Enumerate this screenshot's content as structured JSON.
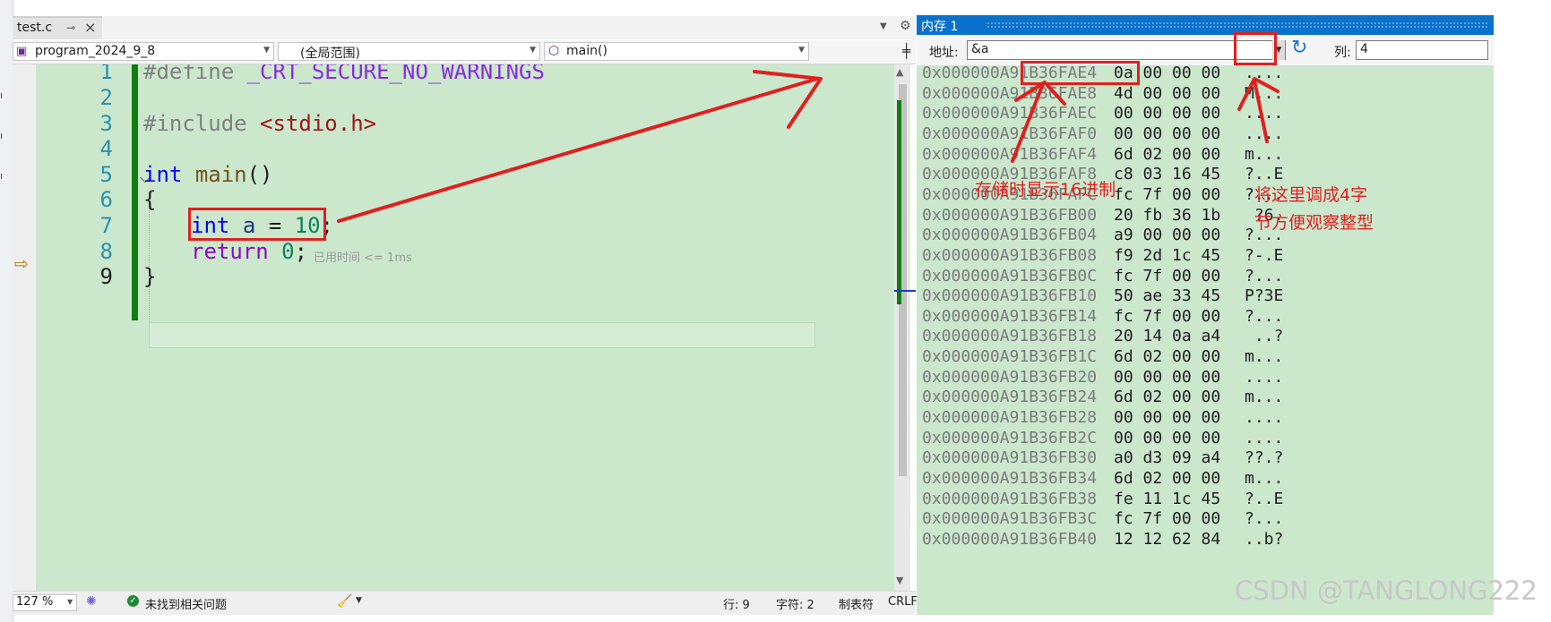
{
  "editor_tab": {
    "label": "test.c",
    "pin": "⊸",
    "close": "×"
  },
  "navbar": {
    "project": "program_2024_9_8",
    "scope": "(全局范围)",
    "member": "main()"
  },
  "editor": {
    "line_numbers": [
      "1",
      "2",
      "3",
      "4",
      "5",
      "6",
      "7",
      "8",
      "9"
    ],
    "lines": {
      "l1_pre": "#define",
      "l1_macro": "_CRT_SECURE_NO_WARNINGS",
      "l3_pre": "#include",
      "l3_str": "<stdio.h>",
      "l5_kw": "int",
      "l5_fn": "main",
      "l5_rest": "()",
      "l6": "{",
      "l7_kw": "int",
      "l7_var": "a",
      "l7_eq": " = ",
      "l7_num": "10",
      "l7_end": ";",
      "l8_kw": "return",
      "l8_num": "0",
      "l8_end": ";",
      "l9": "}"
    },
    "elapsed_hint": "已用时间 <= 1ms"
  },
  "statusbar": {
    "zoom": "127 %",
    "problems": "未找到相关问题",
    "line": "行: 9",
    "char": "字符: 2",
    "tabs": "制表符",
    "eol": "CRLF"
  },
  "memory": {
    "title": "内存 1",
    "address_label": "地址:",
    "address_value": "&a",
    "columns_label": "列:",
    "columns_value": "4",
    "rows": [
      {
        "addr": "0x000000A91B36FAE4",
        "bytes": "0a 00 00 00",
        "text": "...."
      },
      {
        "addr": "0x000000A91B36FAE8",
        "bytes": "4d 00 00 00",
        "text": "M..."
      },
      {
        "addr": "0x000000A91B36FAEC",
        "bytes": "00 00 00 00",
        "text": "...."
      },
      {
        "addr": "0x000000A91B36FAF0",
        "bytes": "00 00 00 00",
        "text": "...."
      },
      {
        "addr": "0x000000A91B36FAF4",
        "bytes": "6d 02 00 00",
        "text": "m..."
      },
      {
        "addr": "0x000000A91B36FAF8",
        "bytes": "c8 03 16 45",
        "text": "?..E"
      },
      {
        "addr": "0x000000A91B36FAFC",
        "bytes": "fc 7f 00 00",
        "text": "?..."
      },
      {
        "addr": "0x000000A91B36FB00",
        "bytes": "20 fb 36 1b",
        "text": " ?6."
      },
      {
        "addr": "0x000000A91B36FB04",
        "bytes": "a9 00 00 00",
        "text": "?..."
      },
      {
        "addr": "0x000000A91B36FB08",
        "bytes": "f9 2d 1c 45",
        "text": "?-.E"
      },
      {
        "addr": "0x000000A91B36FB0C",
        "bytes": "fc 7f 00 00",
        "text": "?..."
      },
      {
        "addr": "0x000000A91B36FB10",
        "bytes": "50 ae 33 45",
        "text": "P?3E"
      },
      {
        "addr": "0x000000A91B36FB14",
        "bytes": "fc 7f 00 00",
        "text": "?..."
      },
      {
        "addr": "0x000000A91B36FB18",
        "bytes": "20 14 0a a4",
        "text": " ..?"
      },
      {
        "addr": "0x000000A91B36FB1C",
        "bytes": "6d 02 00 00",
        "text": "m..."
      },
      {
        "addr": "0x000000A91B36FB20",
        "bytes": "00 00 00 00",
        "text": "...."
      },
      {
        "addr": "0x000000A91B36FB24",
        "bytes": "6d 02 00 00",
        "text": "m..."
      },
      {
        "addr": "0x000000A91B36FB28",
        "bytes": "00 00 00 00",
        "text": "...."
      },
      {
        "addr": "0x000000A91B36FB2C",
        "bytes": "00 00 00 00",
        "text": "...."
      },
      {
        "addr": "0x000000A91B36FB30",
        "bytes": "a0 d3 09 a4",
        "text": "??.?"
      },
      {
        "addr": "0x000000A91B36FB34",
        "bytes": "6d 02 00 00",
        "text": "m..."
      },
      {
        "addr": "0x000000A91B36FB38",
        "bytes": "fe 11 1c 45",
        "text": "?..E"
      },
      {
        "addr": "0x000000A91B36FB3C",
        "bytes": "fc 7f 00 00",
        "text": "?..."
      },
      {
        "addr": "0x000000A91B36FB40",
        "bytes": "12 12 62 84",
        "text": "..b?"
      }
    ]
  },
  "annotations": {
    "hex_note": "存储时显示16进制",
    "cols_note_1": "将这里调成4字",
    "cols_note_2": "节方便观察整型",
    "color": "#e02020"
  },
  "watermark": "CSDN @TANGLONG222"
}
